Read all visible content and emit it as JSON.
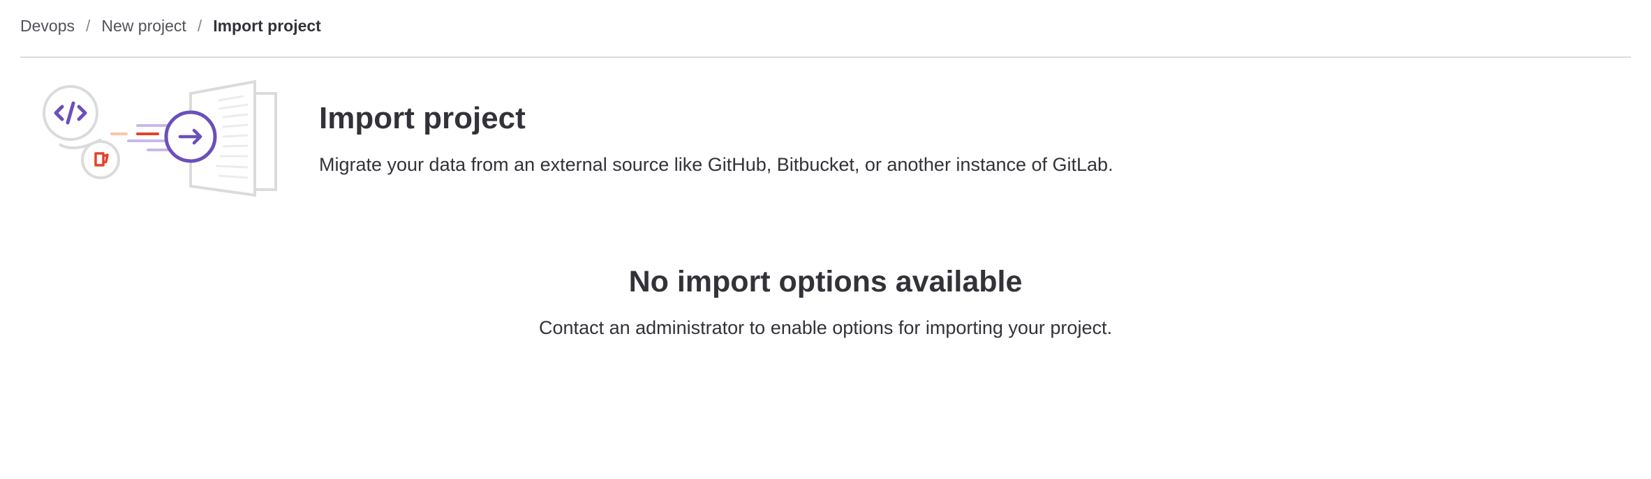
{
  "breadcrumb": {
    "items": [
      "Devops",
      "New project"
    ],
    "current": "Import project",
    "separator": "/"
  },
  "header": {
    "title": "Import project",
    "description": "Migrate your data from an external source like GitHub, Bitbucket, or another instance of GitLab."
  },
  "empty_state": {
    "title": "No import options available",
    "description": "Contact an administrator to enable options for importing your project."
  },
  "colors": {
    "accent_purple": "#6b4fbb",
    "accent_orange": "#e24329",
    "light_orange": "#fdc4a4",
    "light_purple": "#c9b9ec",
    "illustration_gray": "#dbdbdb",
    "divider": "#dcdcde",
    "text": "#333238"
  },
  "icons": [
    "code-icon",
    "cup-icon",
    "arrow-right-icon",
    "document-stack-icon"
  ]
}
